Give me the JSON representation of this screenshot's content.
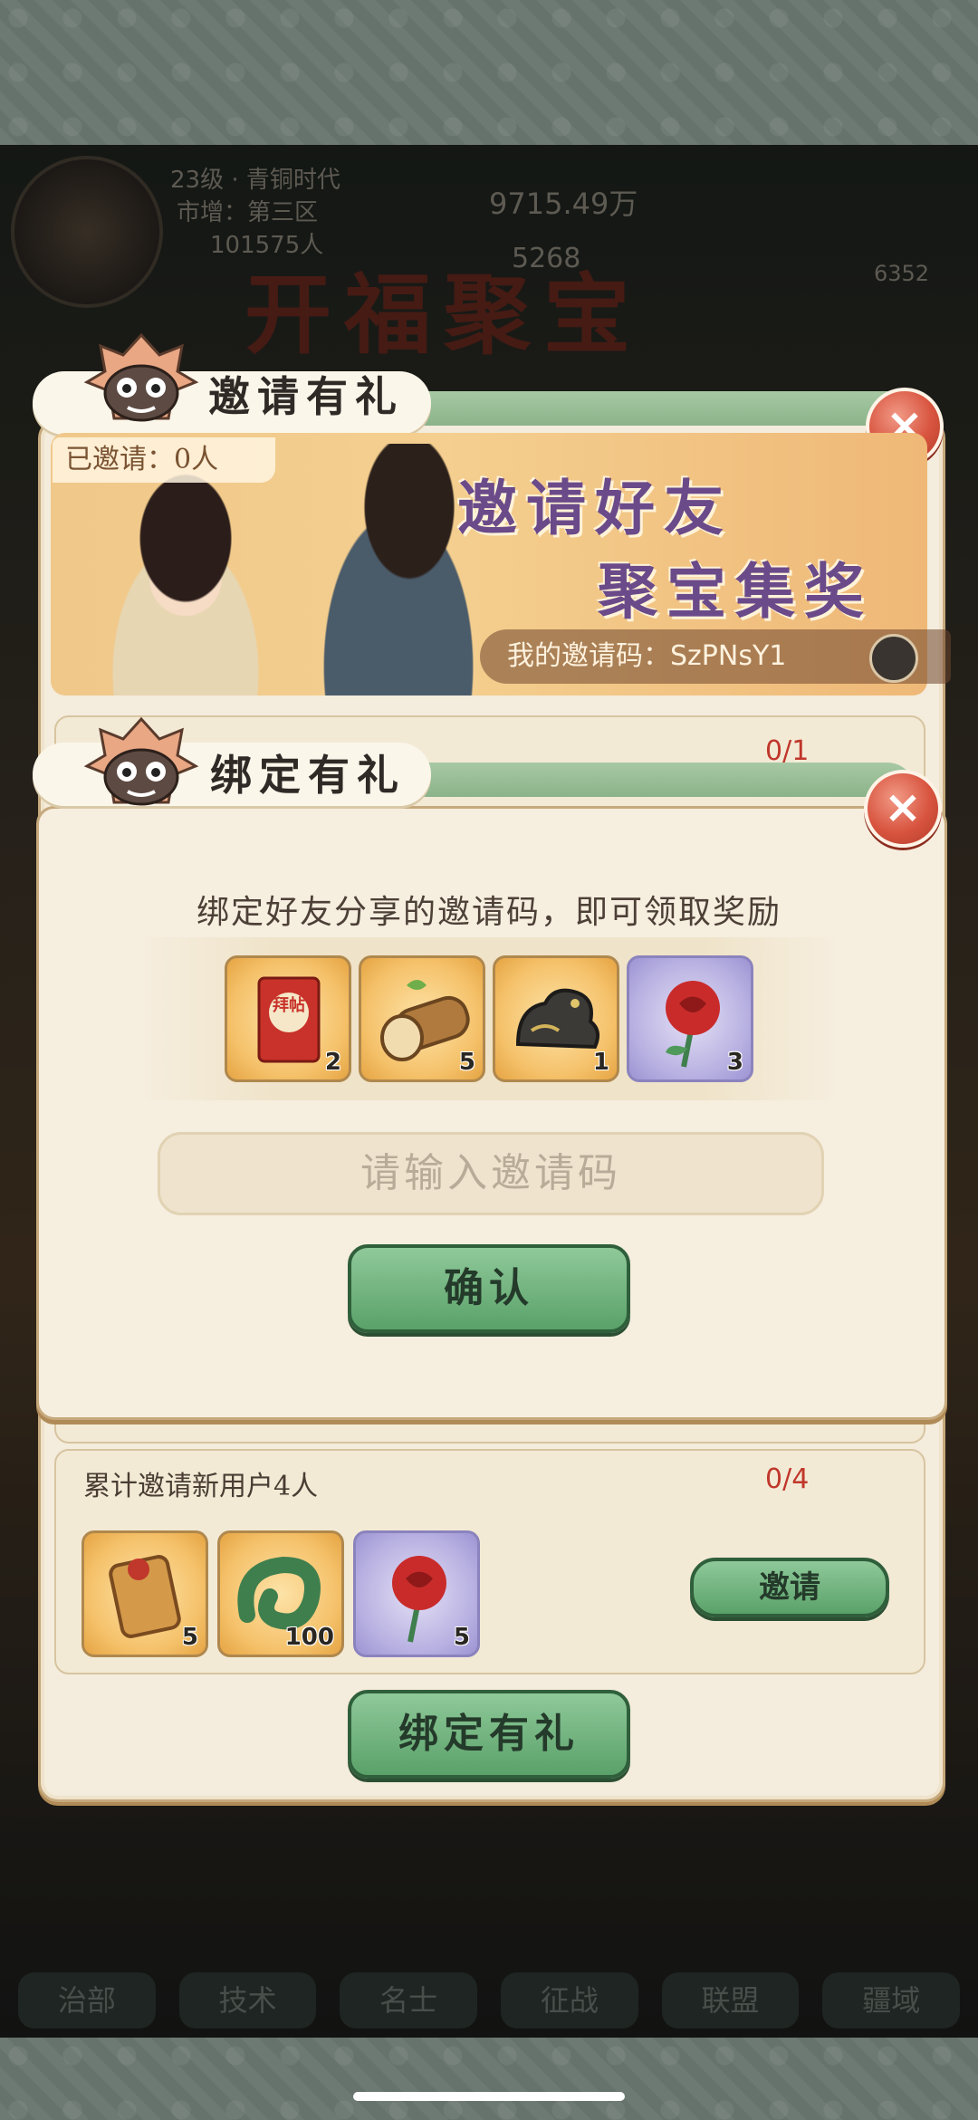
{
  "game_hud": {
    "level_text": "23级 · 青铜时代",
    "sub_text": "市增：第三区",
    "population": "101575人",
    "silver": "9715.49万",
    "resource_a": "5268",
    "resource_b": "6352",
    "event_title": "开福聚宝"
  },
  "bottom_nav": [
    "治部",
    "技术",
    "名士",
    "征战",
    "联盟",
    "疆域"
  ],
  "invite_panel": {
    "header": "邀请有礼",
    "invited_count": "已邀请：0人",
    "banner_line1": "邀请好友",
    "banner_line2": "聚宝集奖",
    "invite_code": "我的邀请码：SzPNsY1",
    "task1_progress": "0/1",
    "task2_title": "累计邀请新用户4人",
    "task2_progress": "0/4",
    "task2_items": [
      {
        "icon": "charm-item-icon",
        "qty": "5"
      },
      {
        "icon": "jade-dragon-icon",
        "qty": "100"
      },
      {
        "icon": "rose-icon",
        "qty": "5"
      }
    ],
    "invite_button": "邀请",
    "bind_button": "绑定有礼"
  },
  "bind_dialog": {
    "header": "绑定有礼",
    "description": "绑定好友分享的邀请码，即可领取奖励",
    "rewards": [
      {
        "icon": "red-card-icon",
        "label": "拜帖",
        "qty": "2"
      },
      {
        "icon": "wood-log-icon",
        "qty": "5"
      },
      {
        "icon": "bronze-beast-icon",
        "qty": "1"
      },
      {
        "icon": "rose-icon",
        "qty": "3"
      }
    ],
    "input_placeholder": "请输入邀请码",
    "confirm_button": "确认"
  },
  "colors": {
    "accent_green": "#5aa169",
    "close_red": "#d8543f",
    "progress_red": "#c0372b",
    "banner_purple": "#6b4a8a"
  }
}
